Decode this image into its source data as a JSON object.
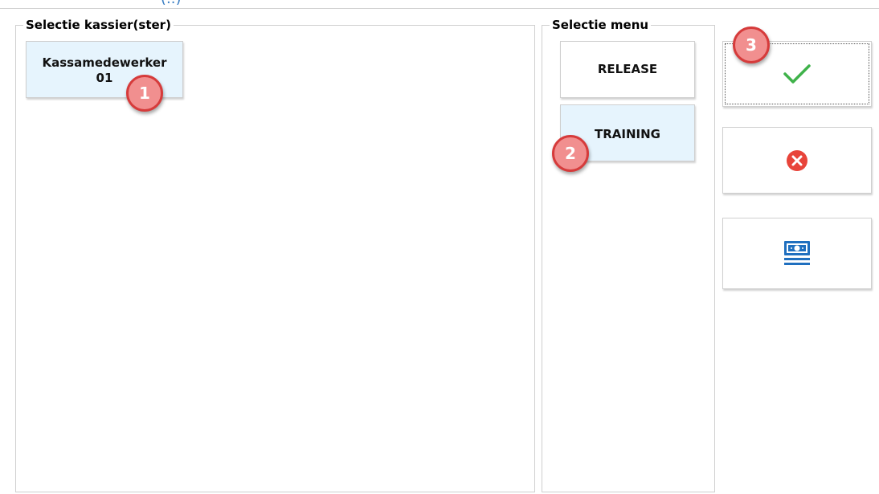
{
  "header": {
    "cut_text": "(..)"
  },
  "cashier_group": {
    "legend": "Selectie kassier(ster)",
    "cashier_tile": {
      "line1": "Kassamedewerker",
      "line2": "01"
    }
  },
  "menu_group": {
    "legend": "Selectie menu",
    "items": [
      {
        "label": "RELEASE"
      },
      {
        "label": "TRAINING"
      }
    ]
  },
  "actions": {
    "confirm_icon": "checkmark-icon",
    "cancel_icon": "cancel-circle-icon",
    "cash_icon": "cash-drawer-icon"
  },
  "markers": [
    "1",
    "2",
    "3"
  ],
  "colors": {
    "tile_selected": "#e6f4fd",
    "checkmark": "#3fb24a",
    "cancel": "#e8443a",
    "cash": "#1f6fbf",
    "marker_fill": "#f18f8f",
    "marker_border": "#d63b3b"
  }
}
